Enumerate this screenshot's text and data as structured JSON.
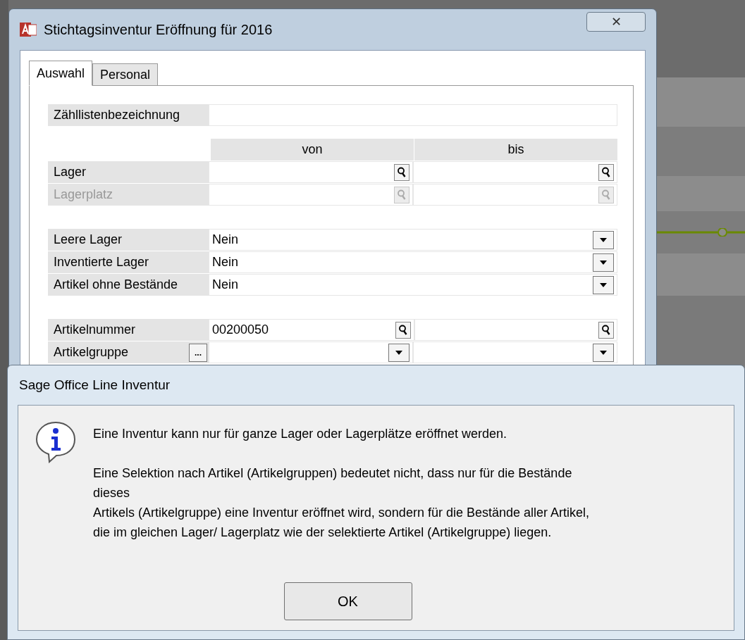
{
  "window": {
    "title": "Stichtagsinventur Eröffnung für 2016",
    "close": "✕"
  },
  "tabs": [
    {
      "label": "Auswahl",
      "selected": true
    },
    {
      "label": "Personal",
      "selected": false
    }
  ],
  "name_field": {
    "label": "Zähllistenbezeichnung"
  },
  "range": {
    "columns": [
      "von",
      "bis"
    ],
    "rows": [
      {
        "label": "Lager",
        "disabled": false
      },
      {
        "label": "Lagerplatz",
        "disabled": true
      }
    ]
  },
  "options": [
    {
      "label": "Leere Lager",
      "value": "Nein"
    },
    {
      "label": "Inventierte Lager",
      "value": "Nein"
    },
    {
      "label": "Artikel ohne Bestände",
      "value": "Nein"
    }
  ],
  "articles": [
    {
      "label": "Artikelnummer",
      "kind": "lookup",
      "from": "00200050"
    },
    {
      "label": "Artikelgruppe",
      "kind": "dropdown",
      "button": "..."
    }
  ],
  "message": {
    "title": "Sage Office Line Inventur",
    "paragraphs": [
      [
        "Eine Inventur kann nur für ganze Lager oder Lagerplätze eröffnet werden."
      ],
      [
        "Eine Selektion nach Artikel (Artikelgruppen) bedeutet nicht, dass nur für die Bestände",
        "dieses",
        "Artikels (Artikelgruppe) eine Inventur eröffnet wird, sondern für die Bestände aller Artikel,",
        "die im gleichen Lager/ Lagerplatz wie der selektierte Artikel (Artikelgruppe) liegen."
      ]
    ],
    "button": "OK"
  }
}
